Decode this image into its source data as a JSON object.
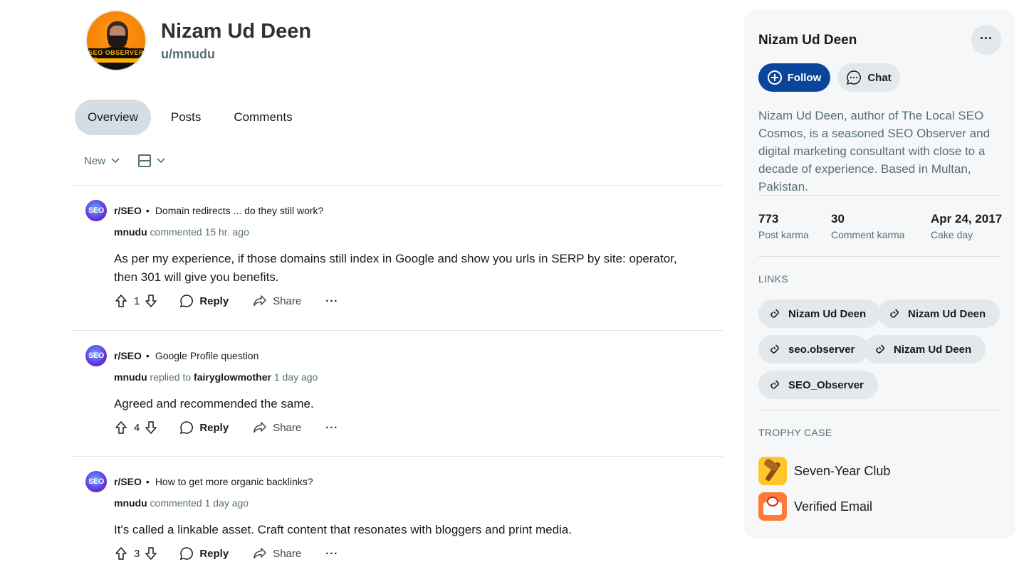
{
  "profile": {
    "display_name": "Nizam Ud Deen",
    "username": "u/mnudu",
    "avatar_text": "SEO OBSERVER"
  },
  "tabs": [
    {
      "label": "Overview",
      "active": true
    },
    {
      "label": "Posts",
      "active": false
    },
    {
      "label": "Comments",
      "active": false
    }
  ],
  "sort": {
    "label": "New"
  },
  "comments": [
    {
      "subreddit": "r/SEO",
      "sub_icon_text": "SEO",
      "post_title": "Domain redirects ... do they still work?",
      "author": "mnudu",
      "action": "commented",
      "reply_to": "",
      "time": "15 hr. ago",
      "body": "As per my experience, if those domains still index in Google and show you urls in SERP by site: operator, then 301 will give you benefits.",
      "votes": "1",
      "reply_label": "Reply",
      "share_label": "Share"
    },
    {
      "subreddit": "r/SEO",
      "sub_icon_text": "SEO",
      "post_title": "Google Profile question",
      "author": "mnudu",
      "action": "replied to",
      "reply_to": "fairyglowmother",
      "time": "1 day ago",
      "body": "Agreed and recommended the same.",
      "votes": "4",
      "reply_label": "Reply",
      "share_label": "Share"
    },
    {
      "subreddit": "r/SEO",
      "sub_icon_text": "SEO",
      "post_title": "How to get more organic backlinks?",
      "author": "mnudu",
      "action": "commented",
      "reply_to": "",
      "time": "1 day ago",
      "body": "It's called a linkable asset. Craft content that resonates with bloggers and print media.",
      "votes": "3",
      "reply_label": "Reply",
      "share_label": "Share"
    }
  ],
  "sidebar": {
    "name": "Nizam Ud Deen",
    "more_label": "···",
    "follow_label": "Follow",
    "chat_label": "Chat",
    "description": "Nizam Ud Deen, author of The Local SEO Cosmos, is a seasoned SEO Observer and digital marketing consultant with close to a decade of experience. Based in Multan, Pakistan.",
    "stats": [
      {
        "value": "773",
        "label": "Post karma"
      },
      {
        "value": "30",
        "label": "Comment karma"
      },
      {
        "value": "Apr 24, 2017",
        "label": "Cake day"
      }
    ],
    "links_heading": "LINKS",
    "links": [
      "Nizam Ud Deen",
      "Nizam Ud Deen",
      "seo.observer",
      "Nizam Ud Deen",
      "SEO_Observer"
    ],
    "trophy_heading": "TROPHY CASE",
    "trophies": [
      "Seven-Year Club",
      "Verified Email"
    ]
  },
  "colors": {
    "follow_button": "#0a449b",
    "active_tab": "#d4dde3",
    "sidebar_bg": "#f6f7f8",
    "muted_text": "#576f76"
  }
}
